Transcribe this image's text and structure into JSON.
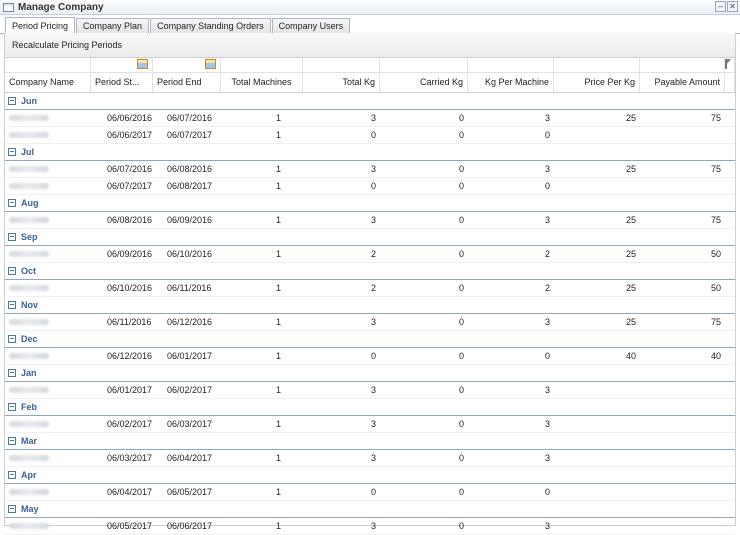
{
  "window": {
    "title": "Manage Company",
    "minimize": "–",
    "close": "✕"
  },
  "tabs": [
    {
      "label": "Period Pricing",
      "active": true
    },
    {
      "label": "Company Plan",
      "active": false
    },
    {
      "label": "Company Standing Orders",
      "active": false
    },
    {
      "label": "Company Users",
      "active": false
    }
  ],
  "toolbar": {
    "recalculate_label": "Recalculate Pricing Periods"
  },
  "grid": {
    "columns": [
      "Company Name",
      "Period St...",
      "Period End",
      "Total Machines",
      "Total Kg",
      "Carried Kg",
      "Kg Per Machine",
      "Price Per Kg",
      "Payable Amount"
    ],
    "groups": [
      {
        "name": "Jun",
        "rows": [
          [
            "06/06/2016",
            "06/07/2016",
            "1",
            "3",
            "0",
            "3",
            "25",
            "75"
          ],
          [
            "06/06/2017",
            "06/07/2017",
            "1",
            "0",
            "0",
            "0",
            "",
            ""
          ]
        ]
      },
      {
        "name": "Jul",
        "rows": [
          [
            "06/07/2016",
            "06/08/2016",
            "1",
            "3",
            "0",
            "3",
            "25",
            "75"
          ],
          [
            "06/07/2017",
            "06/08/2017",
            "1",
            "0",
            "0",
            "0",
            "",
            ""
          ]
        ]
      },
      {
        "name": "Aug",
        "rows": [
          [
            "06/08/2016",
            "06/09/2016",
            "1",
            "3",
            "0",
            "3",
            "25",
            "75"
          ]
        ]
      },
      {
        "name": "Sep",
        "rows": [
          [
            "06/09/2016",
            "06/10/2016",
            "1",
            "2",
            "0",
            "2",
            "25",
            "50"
          ]
        ]
      },
      {
        "name": "Oct",
        "rows": [
          [
            "06/10/2016",
            "06/11/2016",
            "1",
            "2",
            "0",
            "2",
            "25",
            "50"
          ]
        ]
      },
      {
        "name": "Nov",
        "rows": [
          [
            "06/11/2016",
            "06/12/2016",
            "1",
            "3",
            "0",
            "3",
            "25",
            "75"
          ]
        ]
      },
      {
        "name": "Dec",
        "rows": [
          [
            "06/12/2016",
            "06/01/2017",
            "1",
            "0",
            "0",
            "0",
            "40",
            "40"
          ]
        ]
      },
      {
        "name": "Jan",
        "rows": [
          [
            "06/01/2017",
            "06/02/2017",
            "1",
            "3",
            "0",
            "3",
            "",
            ""
          ]
        ]
      },
      {
        "name": "Feb",
        "rows": [
          [
            "06/02/2017",
            "06/03/2017",
            "1",
            "3",
            "0",
            "3",
            "",
            ""
          ]
        ]
      },
      {
        "name": "Mar",
        "rows": [
          [
            "06/03/2017",
            "06/04/2017",
            "1",
            "3",
            "0",
            "3",
            "",
            ""
          ]
        ]
      },
      {
        "name": "Apr",
        "rows": [
          [
            "06/04/2017",
            "06/05/2017",
            "1",
            "0",
            "0",
            "0",
            "",
            ""
          ]
        ]
      },
      {
        "name": "May",
        "rows": [
          [
            "06/05/2017",
            "06/06/2017",
            "1",
            "3",
            "0",
            "3",
            "",
            ""
          ]
        ]
      }
    ]
  }
}
